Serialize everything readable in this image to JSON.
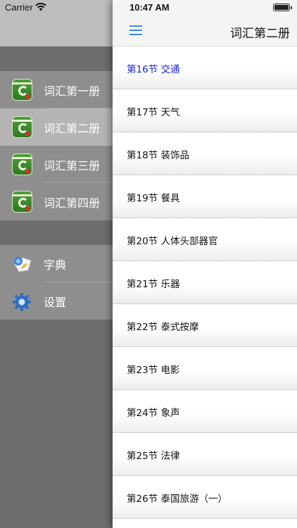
{
  "status_bar": {
    "carrier": "Carrier",
    "time": "10:47 AM"
  },
  "left_menu": {
    "books": [
      {
        "label": "词汇第一册",
        "icon": "vocabulary-book-icon",
        "selected": false
      },
      {
        "label": "词汇第二册",
        "icon": "vocabulary-book-icon",
        "selected": true
      },
      {
        "label": "词汇第三册",
        "icon": "vocabulary-book-icon",
        "selected": false
      },
      {
        "label": "词汇第四册",
        "icon": "vocabulary-book-icon",
        "selected": false
      }
    ],
    "tools": [
      {
        "label": "字典",
        "icon": "dictionary-icon"
      },
      {
        "label": "设置",
        "icon": "gear-icon"
      }
    ]
  },
  "nav": {
    "title": "词汇第二册",
    "menu_icon": "hamburger-icon"
  },
  "lessons": [
    {
      "label": "第16节 交通",
      "active": true
    },
    {
      "label": "第17节 天气",
      "active": false
    },
    {
      "label": "第18节 装饰品",
      "active": false
    },
    {
      "label": "第19节 餐具",
      "active": false
    },
    {
      "label": "第20节 人体头部器官",
      "active": false
    },
    {
      "label": "第21节 乐器",
      "active": false
    },
    {
      "label": "第22节 泰式按摩",
      "active": false
    },
    {
      "label": "第23节 电影",
      "active": false
    },
    {
      "label": "第24节 象声",
      "active": false
    },
    {
      "label": "第25节 法律",
      "active": false
    },
    {
      "label": "第26节 泰国旅游（一）",
      "active": false
    }
  ],
  "colors": {
    "accent": "#3b8be0",
    "active_lesson": "#1a22d6",
    "menu_bg": "#8e8e8e",
    "menu_selected": "#b4b4b4"
  }
}
